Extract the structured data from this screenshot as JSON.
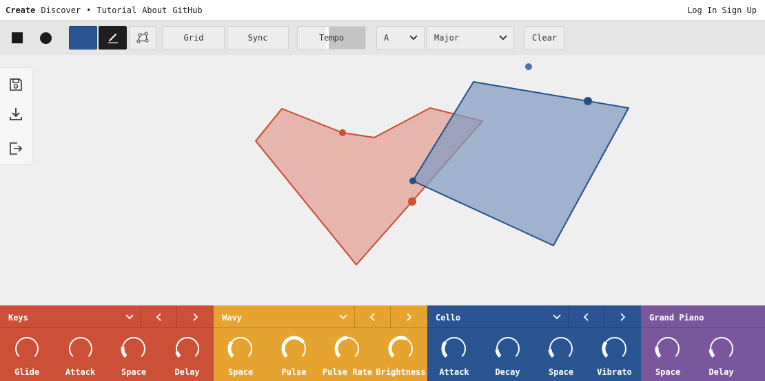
{
  "nav": {
    "create": "Create",
    "discover": "Discover",
    "bullet": "•",
    "tutorial": "Tutorial",
    "about": "About",
    "github": "GitHub",
    "login": "Log In",
    "signup": "Sign Up"
  },
  "toolbar": {
    "grid": "Grid",
    "sync": "Sync",
    "tempo": "Tempo",
    "tempo_level": 0.5,
    "key": "A",
    "scale": "Major",
    "clear": "Clear",
    "color_swatch": "#2a5592"
  },
  "sidepanel": {
    "icons": [
      "save-icon",
      "download-icon",
      "export-icon"
    ]
  },
  "canvas": {
    "shapes": [
      {
        "name": "red-shape",
        "fill": "#e29d90",
        "stroke": "#c94a30"
      },
      {
        "name": "blue-shape",
        "fill": "#7f9bc2",
        "stroke": "#244f8a"
      }
    ]
  },
  "instruments": [
    {
      "name": "Keys",
      "color": "#cc5038",
      "knobs": [
        {
          "label": "Glide",
          "value": 0.0
        },
        {
          "label": "Attack",
          "value": 0.0
        },
        {
          "label": "Space",
          "value": 0.2
        },
        {
          "label": "Delay",
          "value": 0.1
        }
      ]
    },
    {
      "name": "Wavy",
      "color": "#e7a32f",
      "knobs": [
        {
          "label": "Space",
          "value": 0.3
        },
        {
          "label": "Pulse",
          "value": 0.7
        },
        {
          "label": "Pulse Rate",
          "value": 0.5
        },
        {
          "label": "Brightness",
          "value": 0.6
        }
      ]
    },
    {
      "name": "Cello",
      "color": "#2a5592",
      "knobs": [
        {
          "label": "Attack",
          "value": 0.3
        },
        {
          "label": "Decay",
          "value": 0.15
        },
        {
          "label": "Space",
          "value": 0.15
        },
        {
          "label": "Vibrato",
          "value": 0.3
        }
      ]
    },
    {
      "name": "Grand Piano",
      "color": "#7a569c",
      "knobs": [
        {
          "label": "Space",
          "value": 0.2
        },
        {
          "label": "Delay",
          "value": 0.15
        }
      ]
    }
  ]
}
